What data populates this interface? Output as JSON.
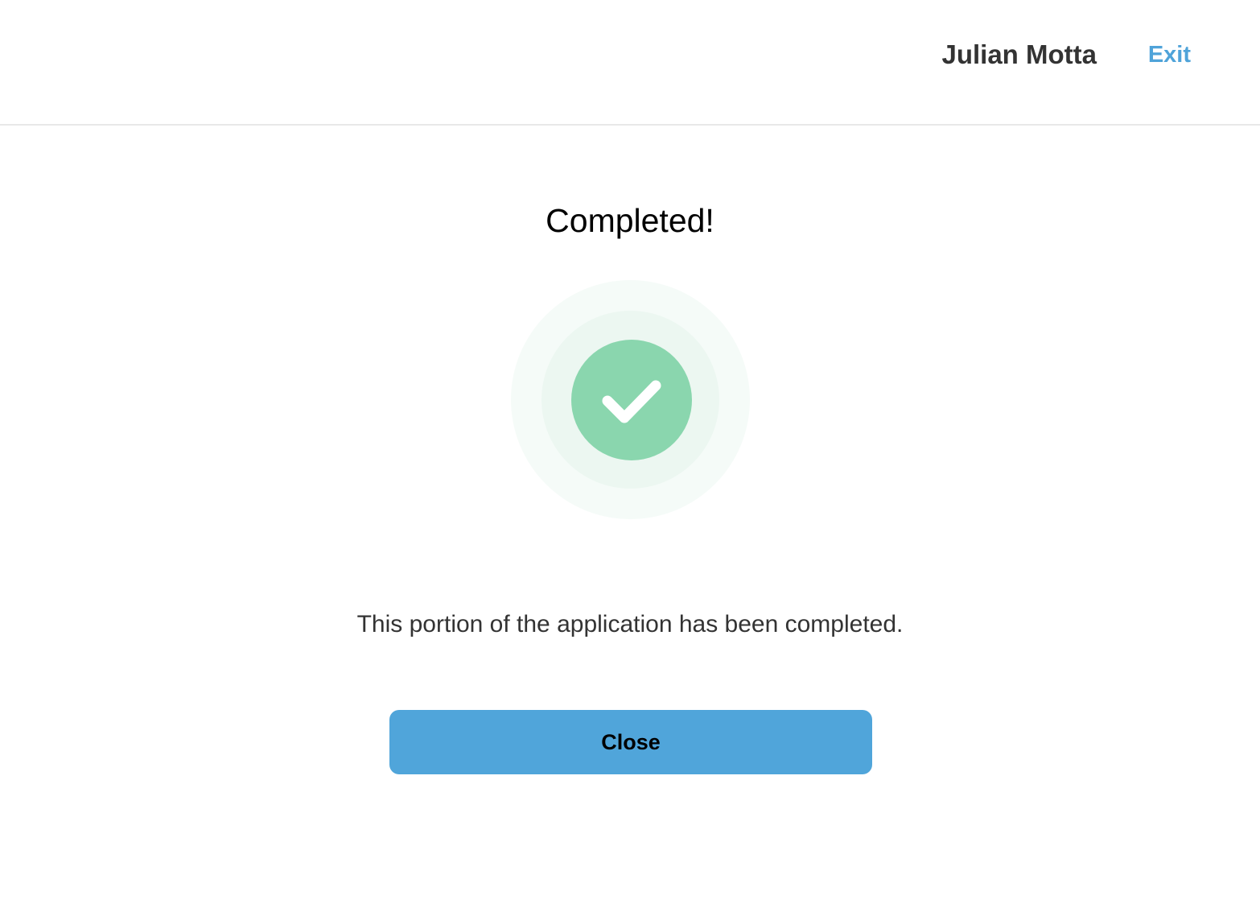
{
  "header": {
    "user_name": "Julian Motta",
    "exit_label": "Exit"
  },
  "main": {
    "title": "Completed!",
    "status_icon": "check-circle-icon",
    "message": "This portion of the application has been completed.",
    "close_label": "Close"
  },
  "colors": {
    "accent": "#4fa3d9",
    "button": "#50a5da",
    "success": "#8ad6ae",
    "divider": "#e8e8e8"
  }
}
